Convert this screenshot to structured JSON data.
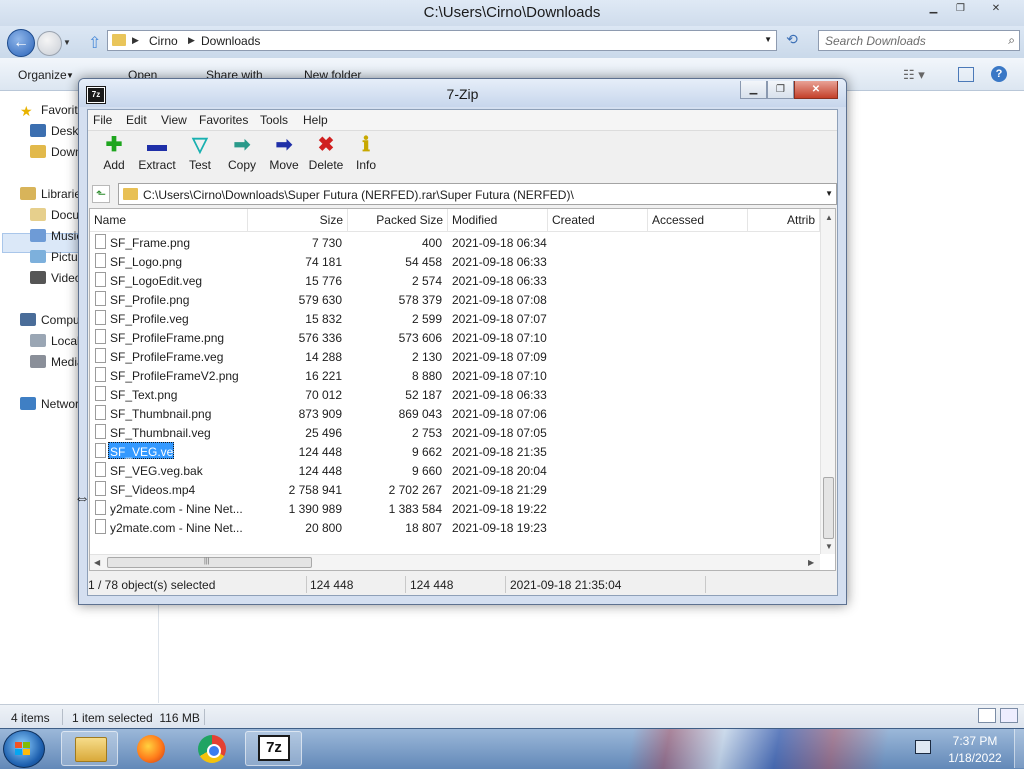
{
  "explorer": {
    "title": "C:\\Users\\Cirno\\Downloads",
    "breadcrumbs": [
      "Cirno",
      "Downloads"
    ],
    "search_placeholder": "Search Downloads",
    "commands": [
      "Organize",
      "Open",
      "Share with",
      "New folder"
    ],
    "nav": {
      "favorites": "Favorites",
      "desktop": "Desktop",
      "downloads": "Downloads",
      "libraries": "Libraries",
      "documents": "Documents",
      "music": "Music",
      "pictures": "Pictures",
      "videos": "Videos",
      "computer": "Computer",
      "local_disk": "Local Disk",
      "media": "Media",
      "network": "Network"
    },
    "status": {
      "items": "4 items",
      "selected": "1 item selected  116 MB"
    }
  },
  "zip": {
    "title": "7-Zip",
    "menu": [
      "File",
      "Edit",
      "View",
      "Favorites",
      "Tools",
      "Help"
    ],
    "tools": [
      {
        "label": "Add",
        "glyph": "✚",
        "color": "#1ea51e",
        "icon": "add-icon"
      },
      {
        "label": "Extract",
        "glyph": "▬",
        "color": "#1f2fa8",
        "icon": "extract-icon"
      },
      {
        "label": "Test",
        "glyph": "▽",
        "color": "#18b0b0",
        "icon": "test-icon"
      },
      {
        "label": "Copy",
        "glyph": "➡",
        "color": "#2a9a8a",
        "icon": "copy-icon"
      },
      {
        "label": "Move",
        "glyph": "➡",
        "color": "#1f2fa8",
        "icon": "move-icon"
      },
      {
        "label": "Delete",
        "glyph": "✖",
        "color": "#d02020",
        "icon": "delete-icon"
      },
      {
        "label": "Info",
        "glyph": "ℹ",
        "color": "#c8a800",
        "icon": "info-icon"
      }
    ],
    "path": "C:\\Users\\Cirno\\Downloads\\Super Futura (NERFED).rar\\Super Futura (NERFED)\\",
    "columns": [
      "Name",
      "Size",
      "Packed Size",
      "Modified",
      "Created",
      "Accessed",
      "Attrib"
    ],
    "files": [
      {
        "name": "SF_Frame.png",
        "size": "7 730",
        "packed": "400",
        "modified": "2021-09-18 06:34"
      },
      {
        "name": "SF_Logo.png",
        "size": "74 181",
        "packed": "54 458",
        "modified": "2021-09-18 06:33"
      },
      {
        "name": "SF_LogoEdit.veg",
        "size": "15 776",
        "packed": "2 574",
        "modified": "2021-09-18 06:33"
      },
      {
        "name": "SF_Profile.png",
        "size": "579 630",
        "packed": "578 379",
        "modified": "2021-09-18 07:08"
      },
      {
        "name": "SF_Profile.veg",
        "size": "15 832",
        "packed": "2 599",
        "modified": "2021-09-18 07:07"
      },
      {
        "name": "SF_ProfileFrame.png",
        "size": "576 336",
        "packed": "573 606",
        "modified": "2021-09-18 07:10"
      },
      {
        "name": "SF_ProfileFrame.veg",
        "size": "14 288",
        "packed": "2 130",
        "modified": "2021-09-18 07:09"
      },
      {
        "name": "SF_ProfileFrameV2.png",
        "size": "16 221",
        "packed": "8 880",
        "modified": "2021-09-18 07:10"
      },
      {
        "name": "SF_Text.png",
        "size": "70 012",
        "packed": "52 187",
        "modified": "2021-09-18 06:33"
      },
      {
        "name": "SF_Thumbnail.png",
        "size": "873 909",
        "packed": "869 043",
        "modified": "2021-09-18 07:06"
      },
      {
        "name": "SF_Thumbnail.veg",
        "size": "25 496",
        "packed": "2 753",
        "modified": "2021-09-18 07:05"
      },
      {
        "name": "SF_VEG.veg",
        "size": "124 448",
        "packed": "9 662",
        "modified": "2021-09-18 21:35",
        "selected": true
      },
      {
        "name": "SF_VEG.veg.bak",
        "size": "124 448",
        "packed": "9 660",
        "modified": "2021-09-18 20:04"
      },
      {
        "name": "SF_Videos.mp4",
        "size": "2 758 941",
        "packed": "2 702 267",
        "modified": "2021-09-18 21:29"
      },
      {
        "name": "y2mate.com - Nine Net...",
        "size": "1 390 989",
        "packed": "1 383 584",
        "modified": "2021-09-18 19:22"
      },
      {
        "name": "y2mate.com - Nine Net...",
        "size": "20 800",
        "packed": "18 807",
        "modified": "2021-09-18 19:23"
      }
    ],
    "status": {
      "selection": "1 / 78 object(s) selected",
      "size": "124 448",
      "packed": "124 448",
      "modified": "2021-09-18 21:35:04"
    }
  },
  "taskbar": {
    "time": "7:37 PM",
    "date": "1/18/2022"
  }
}
